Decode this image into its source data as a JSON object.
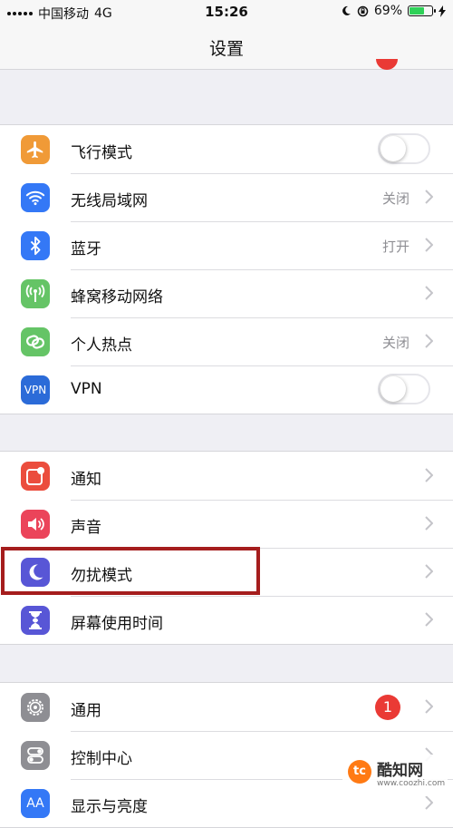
{
  "status_bar": {
    "carrier": "中国移动",
    "network": "4G",
    "time": "15:26",
    "battery": "69%",
    "battery_level": 0.69,
    "icons": [
      "signal-icon",
      "moon-icon",
      "orientation-lock-icon",
      "battery-icon",
      "charging-icon"
    ]
  },
  "nav": {
    "title": "设置"
  },
  "groups": {
    "connectivity": [
      {
        "label": "飞行模式",
        "icon": "airplane-icon",
        "color": "#f09a37",
        "toggle": false
      },
      {
        "label": "无线局域网",
        "icon": "wifi-icon",
        "color": "#3478f6",
        "value": "关闭"
      },
      {
        "label": "蓝牙",
        "icon": "bluetooth-icon",
        "color": "#3478f6",
        "value": "打开"
      },
      {
        "label": "蜂窝移动网络",
        "icon": "cellular-icon",
        "color": "#65c466"
      },
      {
        "label": "个人热点",
        "icon": "hotspot-icon",
        "color": "#65c466",
        "value": "关闭"
      },
      {
        "label": "VPN",
        "icon": "vpn-icon",
        "icon_text": "VPN",
        "color": "#2b6bd8",
        "toggle": false
      }
    ],
    "notifications": [
      {
        "label": "通知",
        "icon": "notifications-icon",
        "color": "#eb4d3d"
      },
      {
        "label": "声音",
        "icon": "sound-icon",
        "color": "#eb445a"
      },
      {
        "label": "勿扰模式",
        "icon": "moon-icon",
        "color": "#5856d6",
        "highlighted": true
      },
      {
        "label": "屏幕使用时间",
        "icon": "hourglass-icon",
        "color": "#5856d6"
      }
    ],
    "general": [
      {
        "label": "通用",
        "icon": "gear-icon",
        "color": "#8e8e93",
        "badge": "1"
      },
      {
        "label": "控制中心",
        "icon": "switches-icon",
        "color": "#8e8e93"
      },
      {
        "label": "显示与亮度",
        "icon": "display-icon",
        "icon_text": "AA",
        "color": "#3478f6"
      }
    ]
  },
  "watermark": {
    "logo": "tc",
    "name": "酷知网",
    "url": "www.coozhi.com"
  }
}
